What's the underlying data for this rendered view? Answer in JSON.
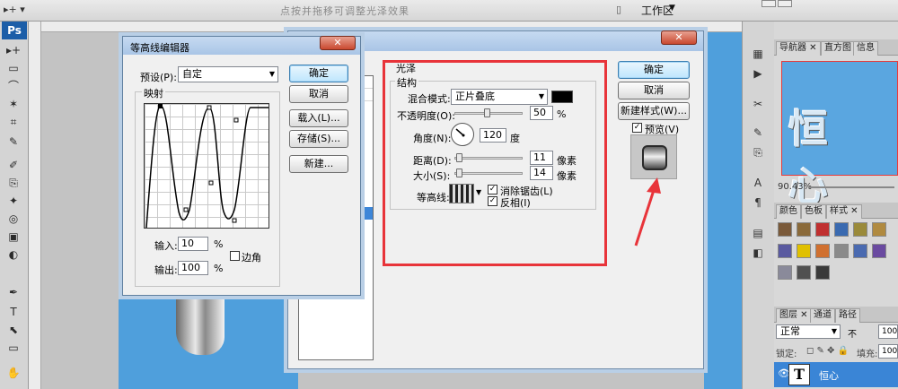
{
  "topbar": {
    "tool_selector": "▸+ ▾",
    "hint": "点按并拖移可调整光泽效果",
    "workspace": "工作区",
    "workspace_arrow": "▼"
  },
  "app": {
    "logo": "Ps"
  },
  "tools": [
    "▸+",
    "▭",
    "⌒",
    "✶",
    "⌗",
    "✎",
    "✐",
    "⎘",
    "✦",
    "◎",
    "▣",
    "◐",
    "✒",
    "T",
    "⬉",
    "▭",
    "✋"
  ],
  "contour_editor": {
    "title": "等高线编辑器",
    "preset_label": "预设(P):",
    "preset_value": "自定",
    "ok": "确定",
    "cancel": "取消",
    "load": "载入(L)...",
    "save": "存储(S)...",
    "new": "新建...",
    "mapping_label": "映射",
    "input_label": "输入:",
    "input_value": "10",
    "output_label": "输出:",
    "output_value": "100",
    "percent": "%",
    "corner_label": "边角"
  },
  "layer_style": {
    "section_title": "光泽",
    "structure_label": "结构",
    "blend_mode_label": "混合模式:",
    "blend_mode_value": "正片叠底",
    "opacity_label": "不透明度(O):",
    "opacity_value": "50",
    "percent": "%",
    "angle_label": "角度(N):",
    "angle_value": "120",
    "degree": "度",
    "distance_label": "距离(D):",
    "distance_value": "11",
    "size_label": "大小(S):",
    "size_value": "14",
    "pixels": "像素",
    "contour_label": "等高线:",
    "anti_alias_label": "消除锯齿(L)",
    "invert_label": "反相(I)",
    "ok": "确定",
    "cancel": "取消",
    "new_style": "新建样式(W)...",
    "preview_label": "预览(V)",
    "close": "✕",
    "anti_alias_checked": true,
    "invert_checked": true,
    "preview_checked": true,
    "highlight_color": "#e8343a"
  },
  "right_panels": {
    "nav_tabs": [
      "导航器",
      "直方图",
      "信息"
    ],
    "zoom": "90.43%",
    "style_tabs": [
      "颜色",
      "色板",
      "样式"
    ],
    "layer_tabs": [
      "图层",
      "通道",
      "路径"
    ],
    "blend_mode": "正常",
    "opacity_short": "100",
    "lock_label": "锁定:",
    "fill_label": "填充:",
    "layer_thumb": "T",
    "layer_name": "恒心",
    "nav_preview_text": "恒 心",
    "style_swatches": [
      "#7a5a3a",
      "#8a6a3a",
      "#c03030",
      "#3a6ab0",
      "#9a8a3a",
      "#b08a40",
      "#5a5aa0",
      "#e0c000",
      "#d07030",
      "#8a8a8a",
      "#4a6ab0",
      "#6a4aa0",
      "#8a8a9a",
      "#505050",
      "#3a3a3a"
    ]
  },
  "canvas": {
    "accent": "#4f9fdc"
  }
}
